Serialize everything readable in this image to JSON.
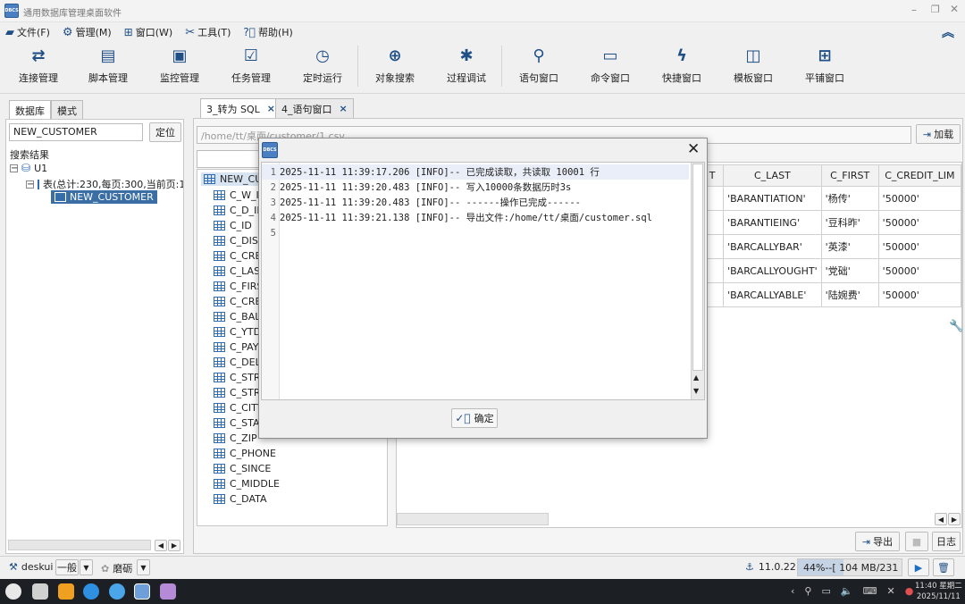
{
  "window": {
    "title": "通用数据库管理桌面软件",
    "logo_text": "DBCS"
  },
  "menu": [
    {
      "icon": "folder-icon",
      "label": "文件(F)"
    },
    {
      "icon": "gear-icon",
      "label": "管理(M)"
    },
    {
      "icon": "windows-icon",
      "label": "窗口(W)"
    },
    {
      "icon": "tools-icon",
      "label": "工具(T)"
    },
    {
      "icon": "help-icon",
      "label": "帮助(H)"
    }
  ],
  "toolbar": [
    {
      "label": "连接管理",
      "glyph": "⇄"
    },
    {
      "label": "脚本管理",
      "glyph": "▤"
    },
    {
      "label": "监控管理",
      "glyph": "▣"
    },
    {
      "label": "任务管理",
      "glyph": "☑"
    },
    {
      "label": "定时运行",
      "glyph": "◷"
    },
    {
      "label": "对象搜索",
      "glyph": "⊕"
    },
    {
      "label": "过程调试",
      "glyph": "✱"
    },
    {
      "label": "语句窗口",
      "glyph": "⚲"
    },
    {
      "label": "命令窗口",
      "glyph": "▭"
    },
    {
      "label": "快捷窗口",
      "glyph": "ϟ"
    },
    {
      "label": "模板窗口",
      "glyph": "◫"
    },
    {
      "label": "平铺窗口",
      "glyph": "⊞"
    }
  ],
  "left": {
    "tabs": [
      "数据库",
      "模式"
    ],
    "search_value": "NEW_CUSTOMER",
    "locate_label": "定位",
    "results_label": "搜索结果",
    "tree_db": "U1",
    "tree_tables": "表(总计:230,每页:300,当前页:1",
    "tree_selected": "NEW_CUSTOMER"
  },
  "tabs": [
    {
      "label": "3_转为 SQL",
      "close": "×"
    },
    {
      "label": "4_语句窗口",
      "close": "×"
    }
  ],
  "path": "/home/tt/桌面/customer/1.csv",
  "load_label": "加载",
  "columns_tree": {
    "root": "NEW_CUS",
    "items": [
      "C_W_II",
      "C_D_ID",
      "C_ID",
      "C_DISC",
      "C_CRE",
      "C_LAST",
      "C_FIRS",
      "C_CRE",
      "C_BAL",
      "C_YTD",
      "C_PAY",
      "C_DEL",
      "C_STR",
      "C_STR",
      "C_CITY",
      "C_STA",
      "C_ZIP",
      "C_PHONE",
      "C_SINCE",
      "C_MIDDLE",
      "C_DATA"
    ]
  },
  "grid": {
    "headers": [
      "T",
      "C_LAST",
      "C_FIRST",
      "C_CREDIT_LIM"
    ],
    "rows": [
      [
        "",
        "'BARANTIATION'",
        "'杨传'",
        "'50000'"
      ],
      [
        "",
        "'BARANTIEING'",
        "'豆科昨'",
        "'50000'"
      ],
      [
        "",
        "'BARCALLYBAR'",
        "'英漆'",
        "'50000'"
      ],
      [
        "",
        "'BARCALLYOUGHT'",
        "'党础'",
        "'50000'"
      ],
      [
        "",
        "'BARCALLYABLE'",
        "'陆婉费'",
        "'50000'"
      ]
    ]
  },
  "dialog": {
    "close": "✕",
    "lines": [
      {
        "n": "1",
        "text": "2025-11-11 11:39:17.206 [INFO]-- 已完成读取，共读取 10001 行"
      },
      {
        "n": "2",
        "text": "2025-11-11 11:39:20.483 [INFO]-- 写入10000条数据历时3s"
      },
      {
        "n": "3",
        "text": "2025-11-11 11:39:20.483 [INFO]-- ------操作已完成------"
      },
      {
        "n": "4",
        "text": "2025-11-11 11:39:21.138 [INFO]-- 导出文件:/home/tt/桌面/customer.sql"
      },
      {
        "n": "5",
        "text": ""
      }
    ],
    "ok_label": "确定"
  },
  "actions": {
    "export_label": "导出",
    "log_label": "日志"
  },
  "status": {
    "user": "deskui",
    "mode": "一般",
    "theme": "磨砺",
    "version": "11.0.22",
    "memory": "44%--[ 104 MB/231 MB ]"
  },
  "taskbar": {
    "time": "11:40 星期二",
    "date": "2025/11/11"
  }
}
